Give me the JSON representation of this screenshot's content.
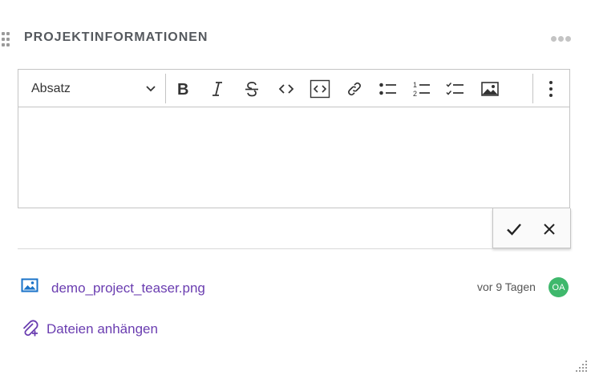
{
  "section": {
    "title": "PROJEKTINFORMATIONEN"
  },
  "editor": {
    "heading_select": {
      "value": "Absatz"
    },
    "toolbar_icons": [
      "bold-icon",
      "italic-icon",
      "strikethrough-icon",
      "code-icon",
      "code-block-icon",
      "link-icon",
      "bulleted-list-icon",
      "numbered-list-icon",
      "todo-list-icon",
      "image-icon",
      "more-vertical-icon"
    ],
    "content": ""
  },
  "actions": {
    "confirm_icon": "check-icon",
    "cancel_icon": "close-icon"
  },
  "attachment": {
    "icon": "image-file-icon",
    "filename": "demo_project_teaser.png",
    "time": "vor 9 Tagen",
    "avatar_initials": "OA",
    "avatar_color": "#3fb86c"
  },
  "attach_link": {
    "label": "Dateien anhängen"
  },
  "colors": {
    "link": "#6a3db0",
    "icon_blue": "#1a73c8",
    "border": "#c4c4c4",
    "title": "#55595e"
  }
}
